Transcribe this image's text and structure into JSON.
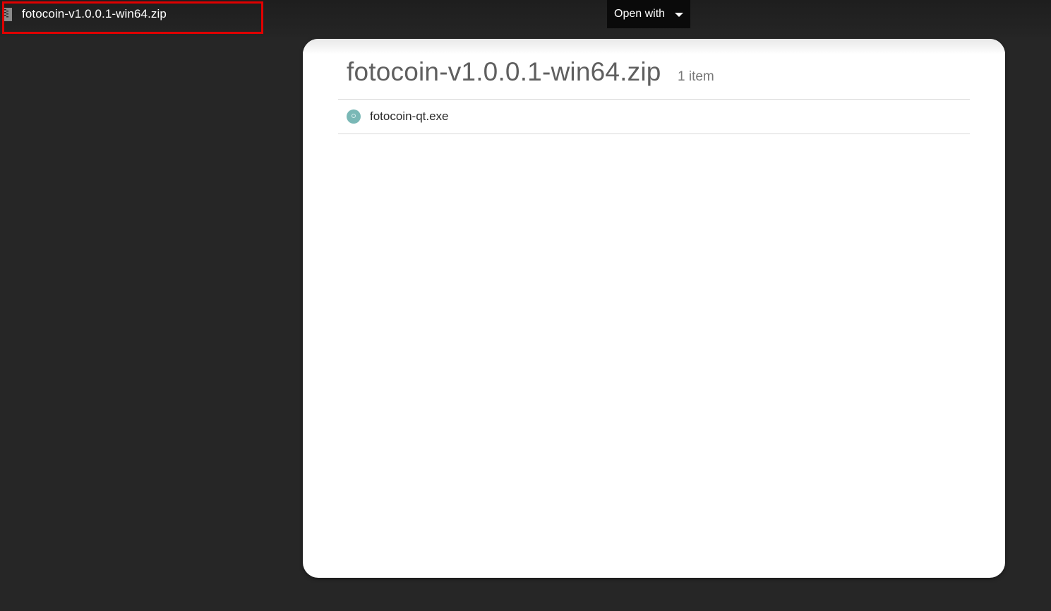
{
  "header": {
    "file_title": "fotocoin-v1.0.0.1-win64.zip",
    "open_with_label": "Open with",
    "file_icon": "zip-file-icon",
    "dropdown_icon": "caret-down-icon"
  },
  "archive": {
    "name": "fotocoin-v1.0.0.1-win64.zip",
    "item_count": "1 item",
    "items": [
      {
        "label": "fotocoin-qt.exe",
        "icon": "executable-file-icon"
      }
    ]
  },
  "colors": {
    "background": "#262626",
    "highlight": "#e00000",
    "exe_icon": "#7ab8b6"
  }
}
